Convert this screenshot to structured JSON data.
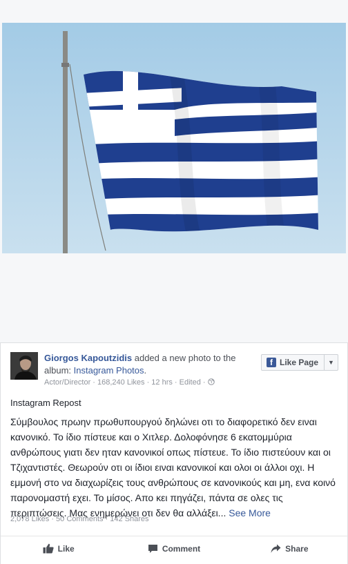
{
  "post": {
    "author": "Giorgos Kapoutzidis",
    "action_text": " added a new photo to the album: ",
    "album": "Instagram Photos",
    "album_suffix": ".",
    "meta": "Actor/Director · 168,240 Likes · 12 hrs · Edited ·",
    "like_page_label": "Like Page",
    "title": "Instagram Repost",
    "body": "Σύμβουλος πρωην πρωθυπουργού δηλώνει οτι το διαφορετικό δεν ειναι κανονικό. Το ίδιο πίστευε και ο Χιτλερ. Δολοφόνησε 6 εκατομμύρια ανθρώπους γιατι δεν ηταν κανονικοί οπως πίστευε. Το ίδιο πιστεύουν και οι Τζιχαντιστές. Θεωρούν οτι οι ίδιοι ειναι κανονικοί και ολοι οι άλλοι οχι. Η εμμονή στο να διαχωρίζεις τους ανθρώπους σε κανονικούς και μη, ενα κοινό παρονομαστή εχει. Το μίσος. Απο κει πηγάζει, πάντα σε ολες τις περιπτώσεις. Μας ενημερώνει οτι δεν θα αλλάξει...",
    "see_more": "See More",
    "stats": "2,078 Likes · 50 Comments · 142 Shares"
  },
  "actions": {
    "like": "Like",
    "comment": "Comment",
    "share": "Share"
  },
  "icons": {
    "facebook": "f",
    "caret": "▼",
    "globe": "globe-icon"
  },
  "colors": {
    "flag_blue": "#1f3f8f",
    "sky": "#a9cfe7",
    "link": "#365899"
  }
}
